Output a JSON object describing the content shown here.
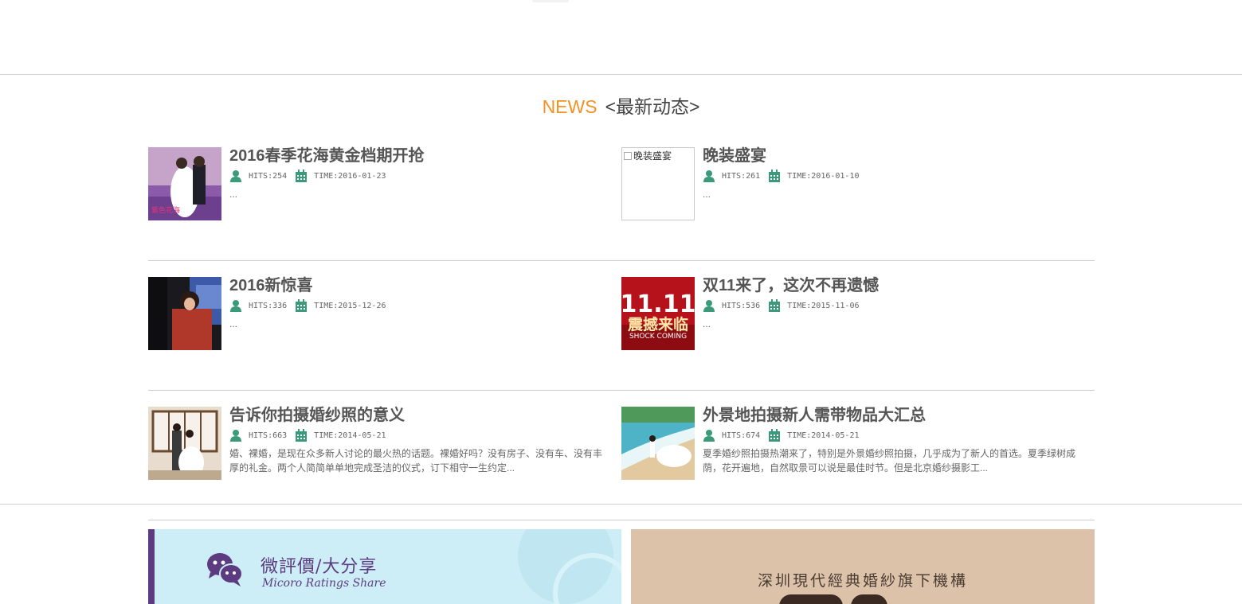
{
  "section": {
    "title_en": "NEWS",
    "title_cn": "<最新动态>"
  },
  "news": [
    {
      "title": "2016春季花海黄金档期开抢",
      "hits": "HITS:254",
      "time": "TIME:2016-01-23",
      "excerpt": "...",
      "thumb": "lavender-field-couple-photo",
      "thumb_caption": "紫色花海"
    },
    {
      "title": "晚装盛宴",
      "hits": "HITS:261",
      "time": "TIME:2016-01-10",
      "excerpt": "...",
      "thumb": "broken-image",
      "thumb_alt": "晚装盛宴"
    },
    {
      "title": "2016新惊喜",
      "hits": "HITS:336",
      "time": "TIME:2015-12-26",
      "excerpt": "...",
      "thumb": "couple-night-photo"
    },
    {
      "title": "双11来了，这次不再遗憾",
      "hits": "HITS:536",
      "time": "TIME:2015-11-06",
      "excerpt": "...",
      "thumb": "double-eleven-banner",
      "thumb_big": "11.11",
      "thumb_cn": "震撼来临",
      "thumb_en": "SHOCK COMING"
    },
    {
      "title": "告诉你拍摄婚纱照的意义",
      "hits": "HITS:663",
      "time": "TIME:2014-05-21",
      "excerpt": "婚、裸婚，是现在众多新人讨论的最火热的话题。裸婚好吗？没有房子、没有车、没有丰厚的礼金。两个人简简单单地完成圣洁的仪式，订下相守一生约定...",
      "thumb": "studio-wedding-photo"
    },
    {
      "title": "外景地拍摄新人需带物品大汇总",
      "hits": "HITS:674",
      "time": "TIME:2014-05-21",
      "excerpt": "夏季婚纱照拍摄热潮来了，特别是外景婚纱照拍摄，几乎成为了新人的首选。夏季绿树成荫，花开遍地，自然取景可以说是最佳时节。但是北京婚纱摄影工...",
      "thumb": "beach-wedding-photo"
    }
  ],
  "banners": {
    "left": {
      "title": "微評價/大分享",
      "subtitle": "Micoro Ratings Share",
      "icon": "wechat-chat-icon"
    },
    "right": {
      "title": "深圳現代經典婚紗旗下機構"
    }
  },
  "colors": {
    "accent": "#f39325",
    "icon_green": "#3a9a7a",
    "banner_purple": "#5c3b80",
    "banner_blue": "#cdeef7",
    "banner_tan": "#dcc2a8"
  }
}
